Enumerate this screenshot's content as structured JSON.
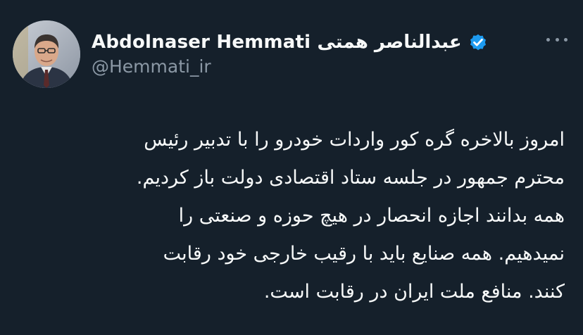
{
  "tweet": {
    "display_name": "Abdolnaser Hemmati عبدالناصر همتی",
    "handle": "@Hemmati_ir",
    "verified_icon": "verified-badge-icon",
    "more_icon": "more-options-icon",
    "lines": [
      "امروز بالاخره گره کور واردات خودرو را با تدبیر رئیس",
      "محترم جمهور در جلسه ستاد اقتصادی دولت باز کردیم.",
      "همه بدانند اجازه انحصار در هیچ حوزه و صنعتی را",
      "نمیدهیم. همه صنایع باید با رقیب خارجی خود رقابت",
      "کنند. منافع ملت ایران در رقابت است."
    ]
  },
  "colors": {
    "background": "#15202b",
    "text": "#f7f9f9",
    "secondary": "#8b98a5",
    "verified": "#1d9bf0"
  }
}
